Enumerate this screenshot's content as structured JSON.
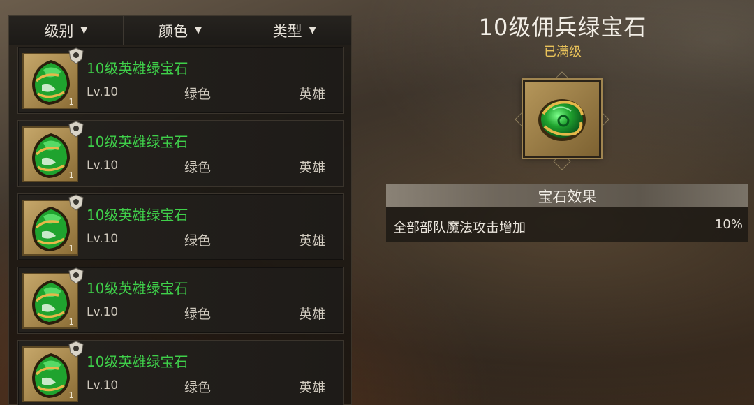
{
  "filters": [
    {
      "label": "级别"
    },
    {
      "label": "颜色"
    },
    {
      "label": "类型"
    }
  ],
  "gems": [
    {
      "name": "10级英雄绿宝石",
      "level": "Lv.10",
      "color": "绿色",
      "type": "英雄",
      "count": "1",
      "badge_icon": "shield-badge-icon"
    },
    {
      "name": "10级英雄绿宝石",
      "level": "Lv.10",
      "color": "绿色",
      "type": "英雄",
      "count": "1",
      "badge_icon": "helmet-badge-icon"
    },
    {
      "name": "10级英雄绿宝石",
      "level": "Lv.10",
      "color": "绿色",
      "type": "英雄",
      "count": "1",
      "badge_icon": "mage-badge-icon"
    },
    {
      "name": "10级英雄绿宝石",
      "level": "Lv.10",
      "color": "绿色",
      "type": "英雄",
      "count": "1",
      "badge_icon": "sword-badge-icon"
    },
    {
      "name": "10级英雄绿宝石",
      "level": "Lv.10",
      "color": "绿色",
      "type": "英雄",
      "count": "1",
      "badge_icon": "archer-badge-icon"
    }
  ],
  "detail": {
    "title": "10级佣兵绿宝石",
    "status": "已满级",
    "effect_header": "宝石效果",
    "effects": [
      {
        "label": "全部部队魔法攻击增加",
        "value": "10%"
      }
    ]
  },
  "colors": {
    "gem_name_green": "#3fd04a",
    "max_level_gold": "#e9c25a",
    "gem_green": "#1fa32e"
  }
}
